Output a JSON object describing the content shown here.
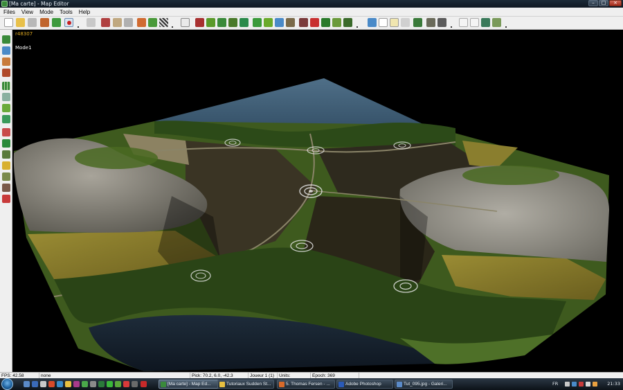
{
  "window": {
    "title": "[Ma carte] - Map Editor"
  },
  "menu": [
    "Files",
    "View",
    "Mode",
    "Tools",
    "Help"
  ],
  "toolbar_icons": [
    "new-icon",
    "open-icon",
    "save-icon",
    "brush-icon",
    "fill-icon",
    "flag-icon",
    "undo-icon",
    "edit-icon",
    "paint-icon",
    "mountain-icon",
    "terrain-green-icon",
    "grid-icon",
    "checker-icon",
    "pointer-icon",
    "tree-icon",
    "forest-icon",
    "road-icon",
    "grass-icon",
    "field-icon",
    "unit-icon",
    "house-icon",
    "water-icon",
    "rock-icon",
    "object-icon",
    "fire-icon",
    "bush-icon",
    "crop-icon",
    "export-icon",
    "image-icon",
    "text-icon",
    "copy-icon",
    "plant-icon",
    "settings-icon",
    "tools-icon",
    "frame-icon",
    "window-icon",
    "screenshot-icon",
    "terrain-icon"
  ],
  "left_tools": [
    "select-tool-icon",
    "water-tool-icon",
    "house-tool-icon",
    "building-tool-icon",
    "grid-tool-icon",
    "road-tool-icon",
    "texture-tool-icon",
    "field-tool-icon",
    "object-tool-icon",
    "tree-tool-icon",
    "bush-tool-icon",
    "forest-tool-icon",
    "fence-tool-icon",
    "unit-tool-icon",
    "flag-tool-icon"
  ],
  "viewport": {
    "revision": "r48307",
    "mode_label": "Mode1"
  },
  "statusbar": {
    "fps": "FPS: 42.58",
    "selection": "none",
    "pick": "Pick: 70.2, 6.0, -42.3",
    "player": "Joueur 1 (1)",
    "units": "Units:",
    "epoch": "Epoch: 369"
  },
  "taskbar": {
    "tasks": [
      {
        "label": "[Ma carte] - Map Ed...",
        "active": true
      },
      {
        "label": "Tutoriaux Sudden St...",
        "active": false
      },
      {
        "label": "5. Thomas Fersen - ...",
        "active": false
      },
      {
        "label": "Adobe Photoshop",
        "active": false
      },
      {
        "label": "Tut_095.jpg - Galeri...",
        "active": false
      }
    ],
    "language": "FR",
    "time": "21:33"
  },
  "colors": {
    "title_bar": "#14202b",
    "chrome": "#efefef",
    "revision_text": "#d9a520",
    "water": "#3f5f78",
    "grass": "#5a7a2a",
    "field": "#8a7e2e",
    "rock": "#8c8a84"
  }
}
